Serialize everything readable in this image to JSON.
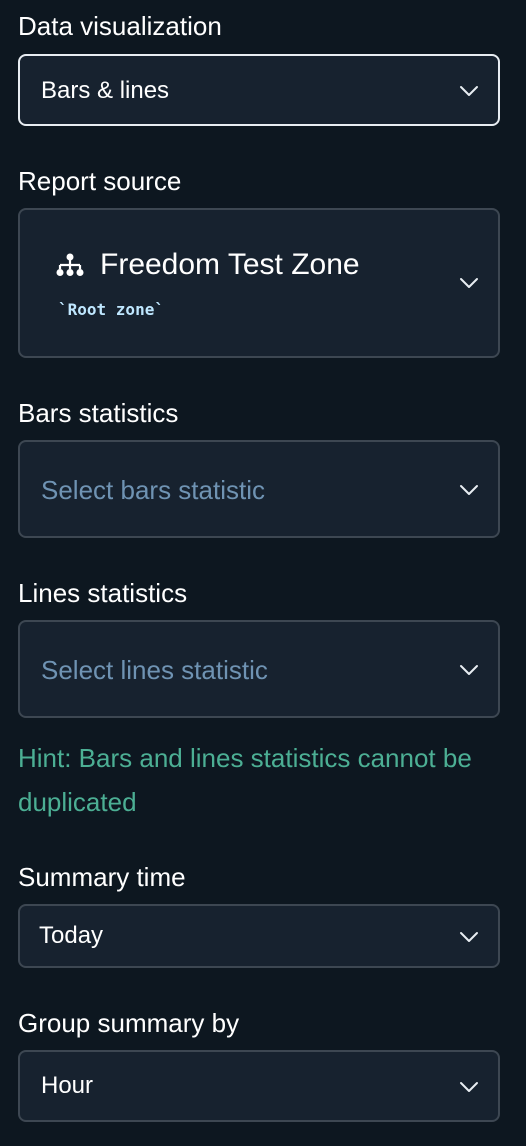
{
  "data_visualization": {
    "label": "Data visualization",
    "value": "Bars & lines"
  },
  "report_source": {
    "label": "Report source",
    "zone_name": "Freedom Test Zone",
    "zone_type": "`Root zone`",
    "icon": "hierarchy-icon"
  },
  "bars_statistics": {
    "label": "Bars statistics",
    "placeholder": "Select bars statistic"
  },
  "lines_statistics": {
    "label": "Lines statistics",
    "placeholder": "Select lines statistic"
  },
  "hint": "Hint: Bars and lines statistics cannot be duplicated",
  "summary_time": {
    "label": "Summary time",
    "value": "Today"
  },
  "group_summary_by": {
    "label": "Group summary by",
    "value": "Hour"
  },
  "colors": {
    "background": "#0d1720",
    "field": "#17222f",
    "border": "#3d4752",
    "focus_border": "#e8edf2",
    "placeholder": "#6f93b3",
    "hint": "#4caf94"
  }
}
